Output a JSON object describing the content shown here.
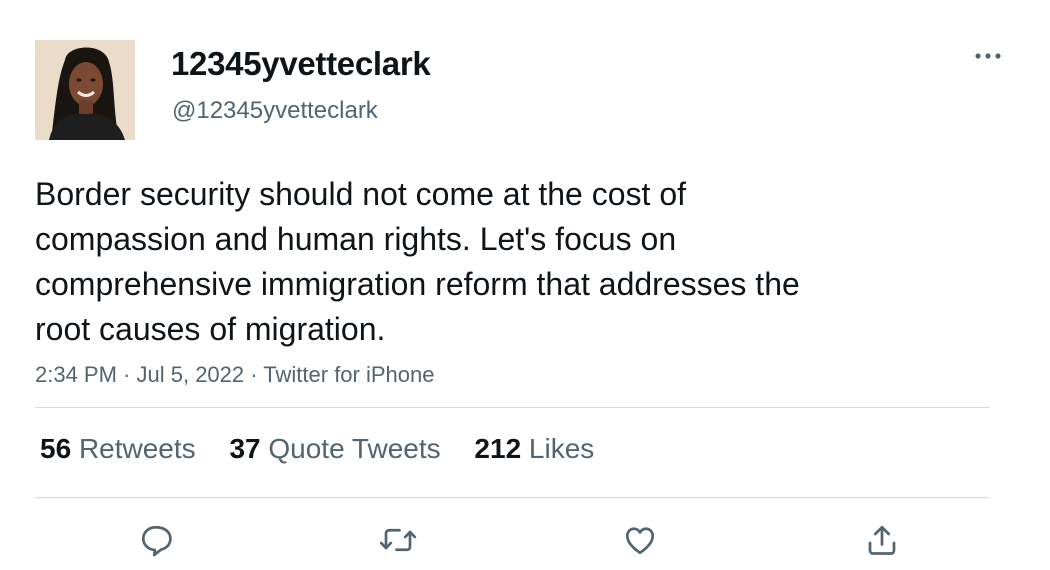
{
  "user": {
    "display_name": "12345yvetteclark",
    "handle": "@12345yvetteclark",
    "avatar_icon": "profile-photo"
  },
  "tweet": {
    "text": "Border security should not come at the cost of\ncompassion and human rights. Let's focus on\ncomprehensive immigration reform that addresses the\nroot causes of migration.",
    "time": "2:34 PM",
    "separator": " · ",
    "date": "Jul 5, 2022",
    "source": "Twitter for iPhone"
  },
  "stats": {
    "retweets": {
      "count": "56",
      "label": "Retweets"
    },
    "quote_tweets": {
      "count": "37",
      "label": "Quote Tweets"
    },
    "likes": {
      "count": "212",
      "label": "Likes"
    }
  },
  "actions": [
    {
      "name": "reply",
      "icon": "speech-bubble-icon"
    },
    {
      "name": "retweet",
      "icon": "retweet-arrows-icon"
    },
    {
      "name": "like",
      "icon": "heart-icon"
    },
    {
      "name": "share",
      "icon": "share-upload-icon"
    }
  ],
  "colors": {
    "text_primary": "#0f1419",
    "text_secondary": "#536471",
    "divider": "#cfd9de",
    "background": "#ffffff"
  }
}
